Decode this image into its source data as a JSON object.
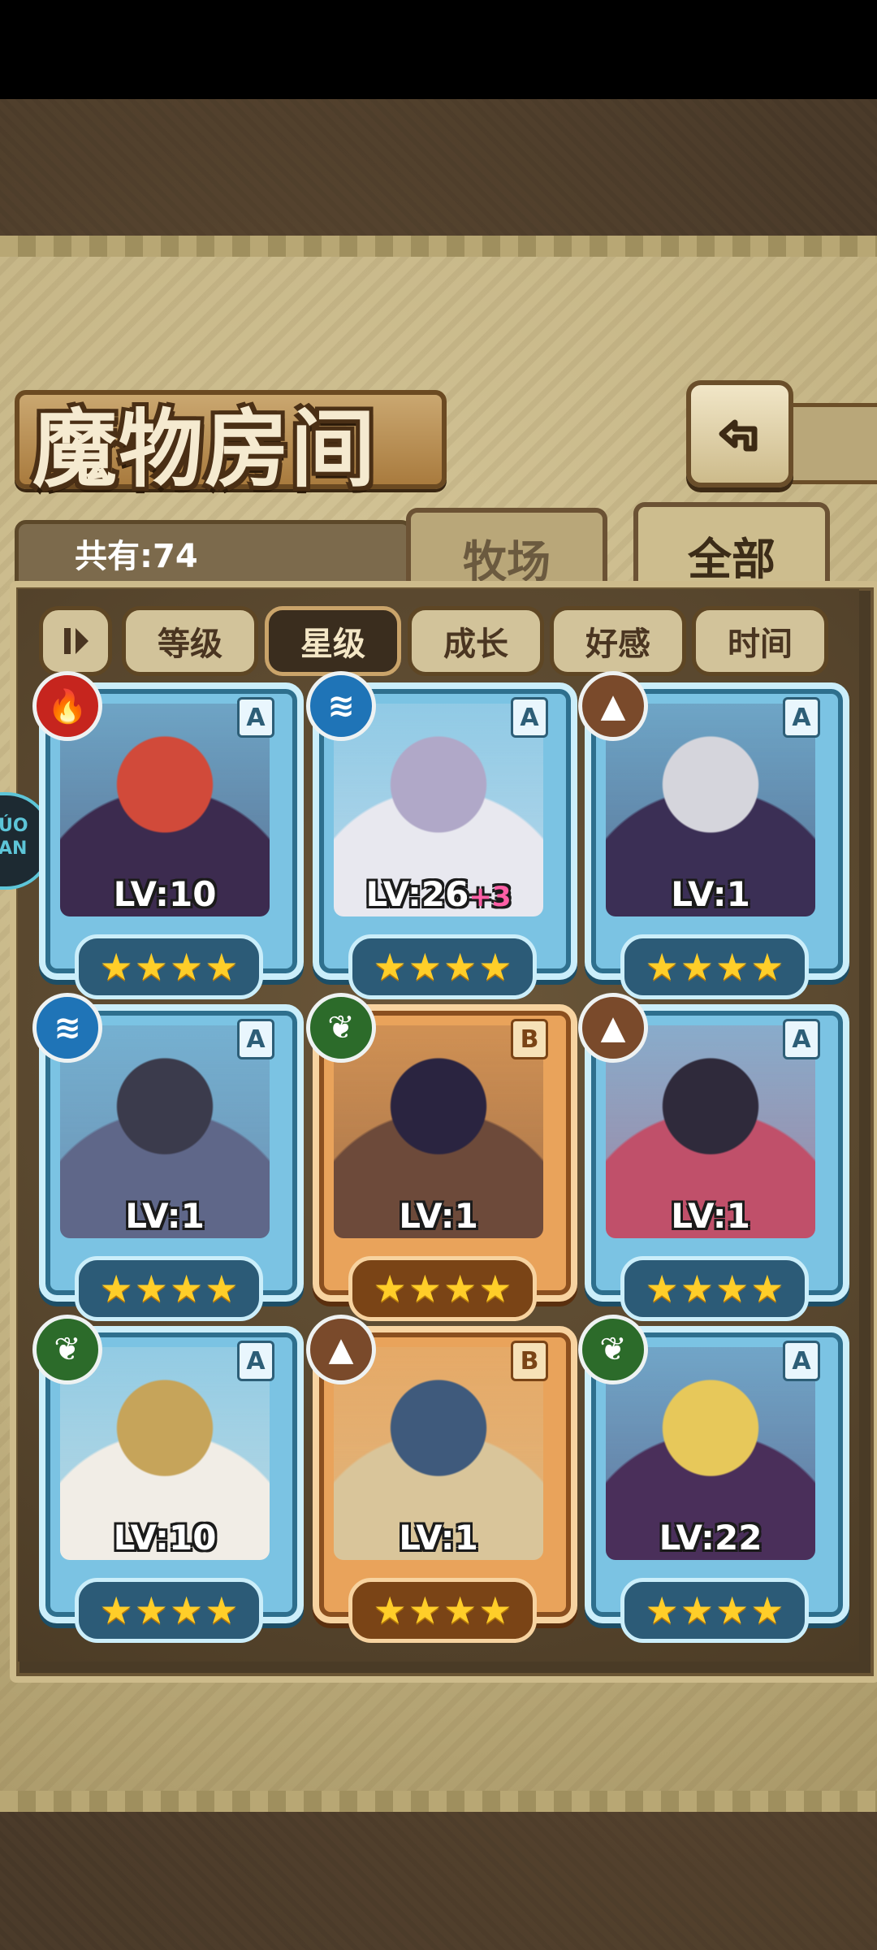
{
  "header": {
    "title": "魔物房间",
    "back_icon": "back-arrow-icon"
  },
  "summary": {
    "count_label": "共有:74"
  },
  "tabs": [
    {
      "label": "牧场",
      "active": false
    },
    {
      "label": "全部",
      "active": true
    }
  ],
  "sort": {
    "pause_icon": "pause-icon",
    "buttons": [
      {
        "label": "等级",
        "active": false
      },
      {
        "label": "星级",
        "active": true
      },
      {
        "label": "成长",
        "active": false
      },
      {
        "label": "好感",
        "active": false
      },
      {
        "label": "时间",
        "active": false
      }
    ]
  },
  "side_badge": {
    "text": "ÚO\nAN"
  },
  "monsters": [
    {
      "element": "fire",
      "rank": "A",
      "frame": "blue",
      "level": "LV:10",
      "bonus": "",
      "stars": 4
    },
    {
      "element": "water",
      "rank": "A",
      "frame": "blue",
      "level": "LV:26",
      "bonus": "+3",
      "stars": 4
    },
    {
      "element": "earth",
      "rank": "A",
      "frame": "blue",
      "level": "LV:1",
      "bonus": "",
      "stars": 4
    },
    {
      "element": "water",
      "rank": "A",
      "frame": "blue",
      "level": "LV:1",
      "bonus": "",
      "stars": 4
    },
    {
      "element": "wood",
      "rank": "B",
      "frame": "orange",
      "level": "LV:1",
      "bonus": "",
      "stars": 4
    },
    {
      "element": "earth",
      "rank": "A",
      "frame": "blue",
      "level": "LV:1",
      "bonus": "",
      "stars": 4
    },
    {
      "element": "wood",
      "rank": "A",
      "frame": "blue",
      "level": "LV:10",
      "bonus": "",
      "stars": 4
    },
    {
      "element": "earth",
      "rank": "B",
      "frame": "orange",
      "level": "LV:1",
      "bonus": "",
      "stars": 4
    },
    {
      "element": "wood",
      "rank": "A",
      "frame": "blue",
      "level": "LV:22",
      "bonus": "",
      "stars": 4
    }
  ],
  "colors": {
    "fire": "#c6251e",
    "water": "#1f74b7",
    "earth": "#7a4a2b",
    "wood": "#2c6b2a",
    "star": "#ffce29"
  }
}
